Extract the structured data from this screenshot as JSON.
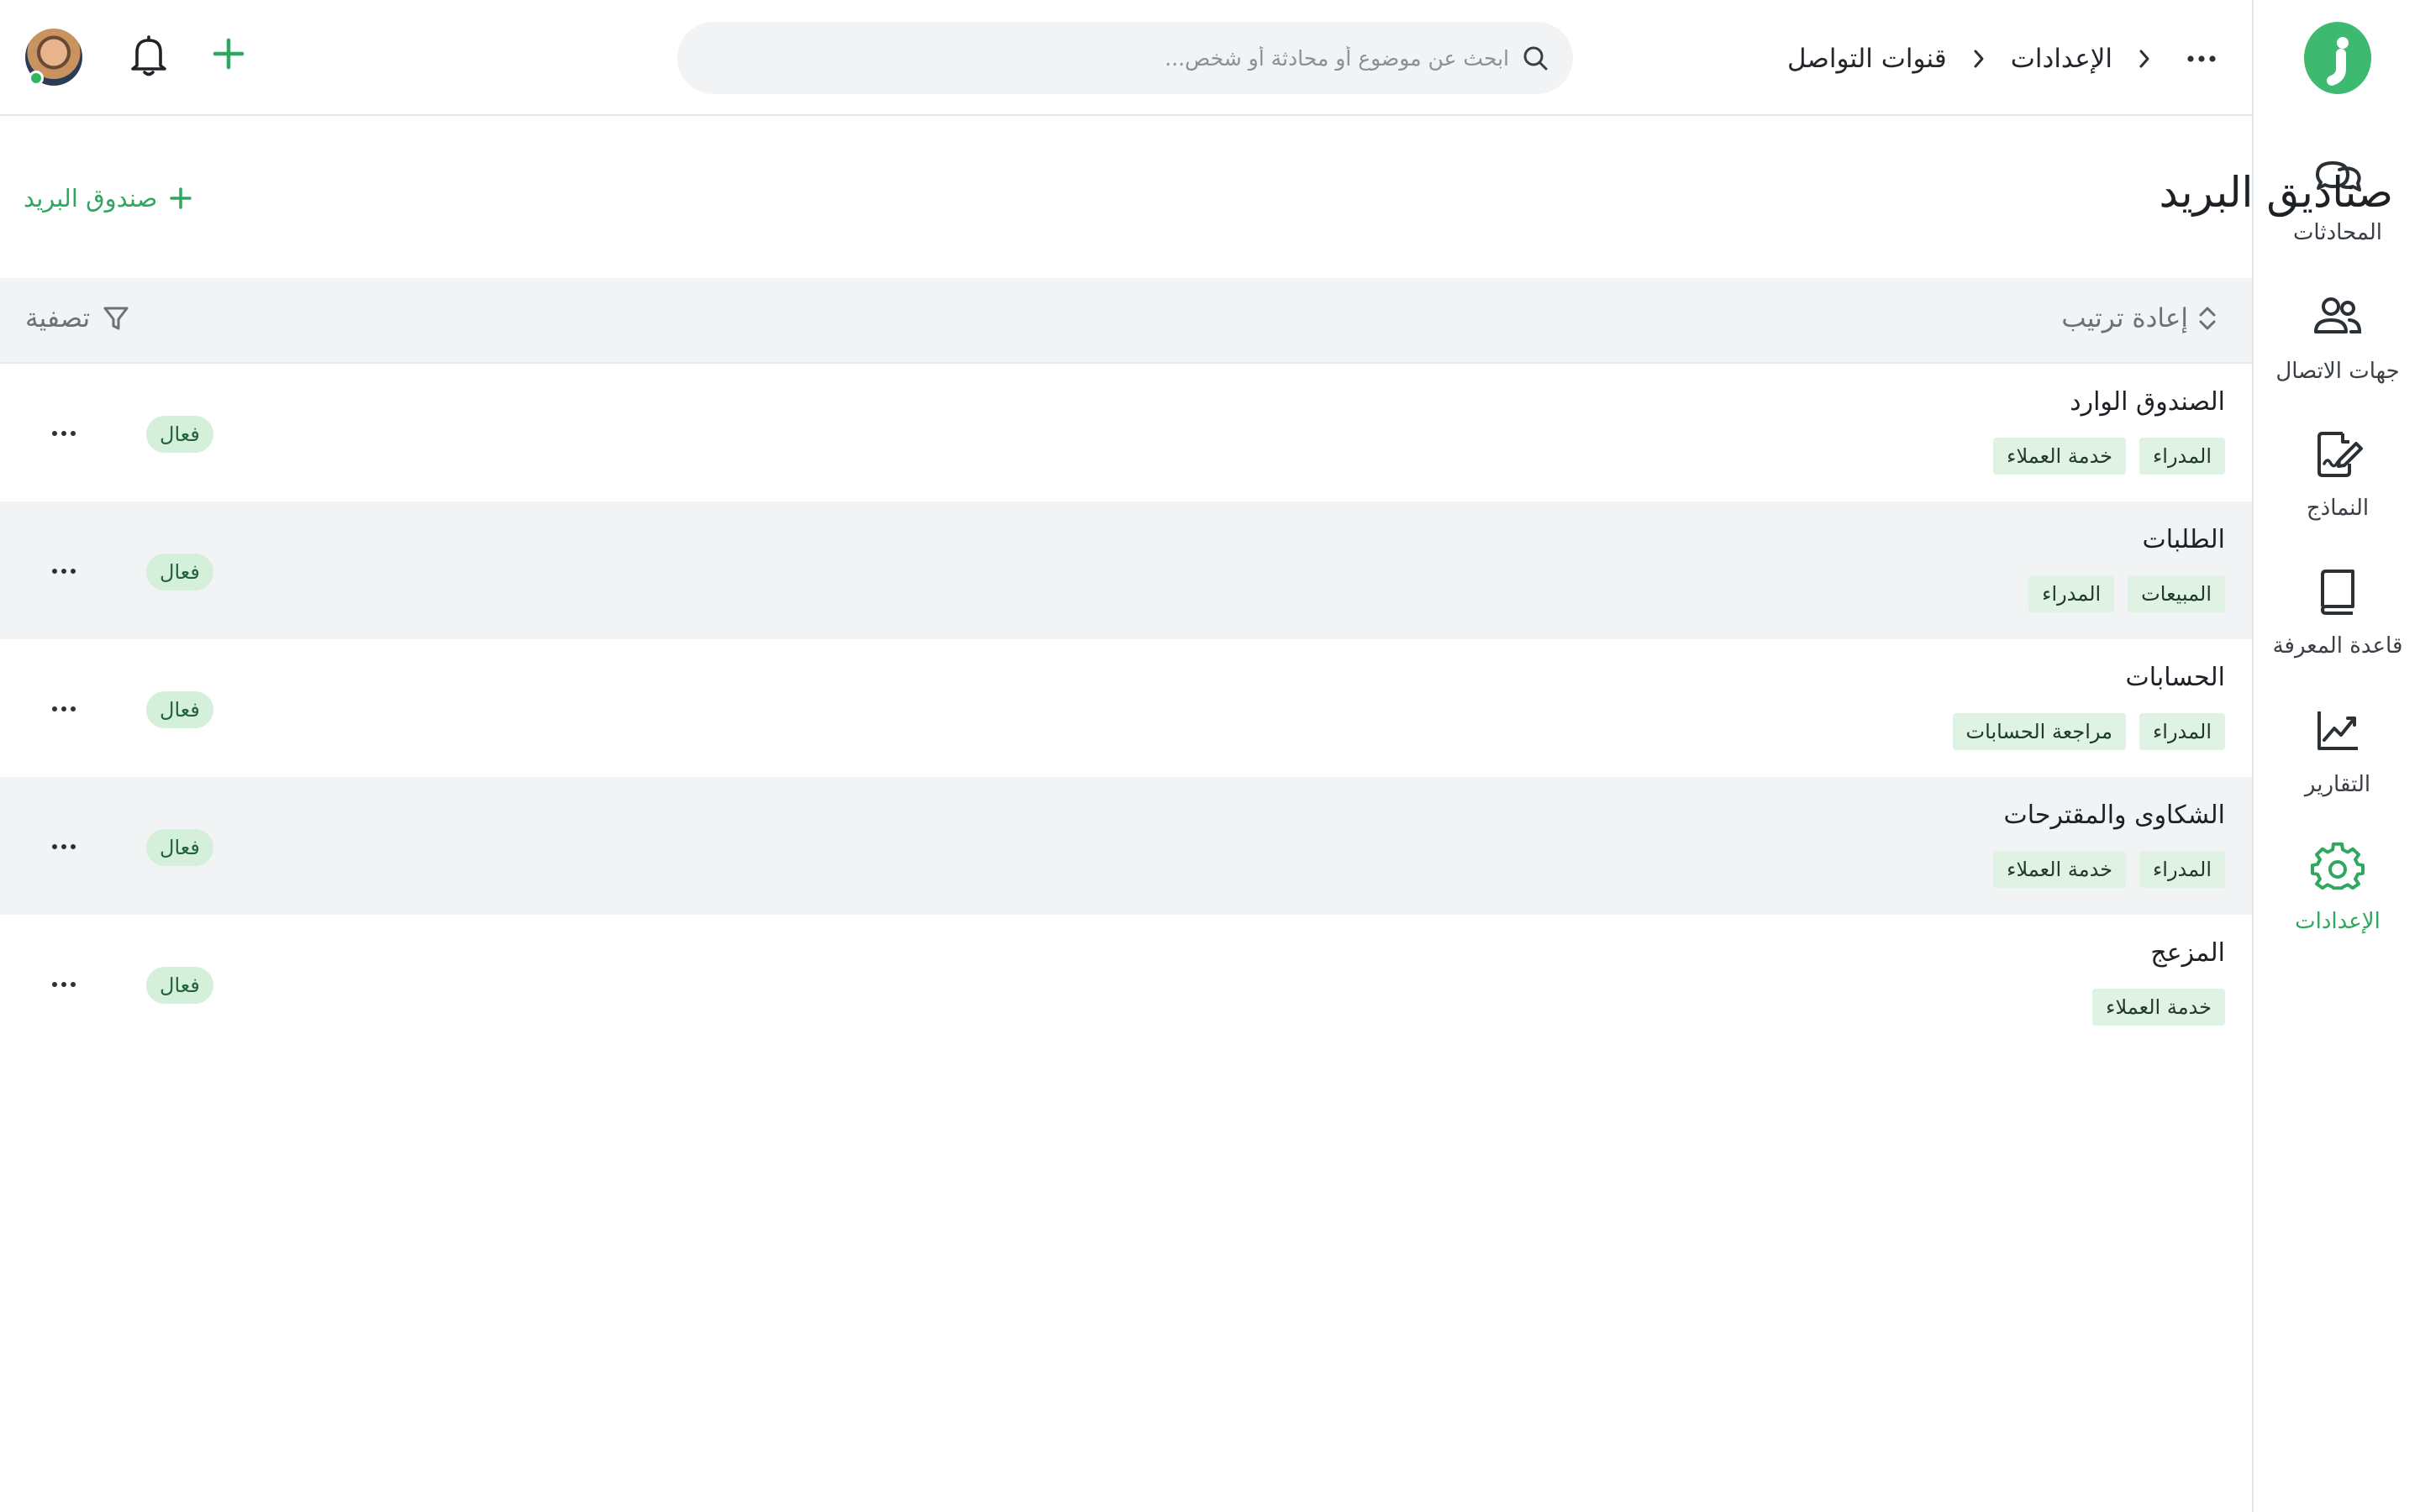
{
  "colors": {
    "accent": "#3dba6f",
    "accent_text": "#2fa75f",
    "tag_bg": "#dff2e4",
    "status_bg": "#d4efda",
    "toolbar_bg": "#f2f3f4",
    "online": "#2fb55f"
  },
  "sidebar": {
    "logo_icon": "info-logo-icon",
    "items": [
      {
        "label": "المحادثات",
        "icon": "chat-bubbles-icon",
        "active": false
      },
      {
        "label": "جهات الاتصال",
        "icon": "contacts-icon",
        "active": false
      },
      {
        "label": "النماذج",
        "icon": "form-edit-icon",
        "active": false
      },
      {
        "label": "قاعدة المعرفة",
        "icon": "book-icon",
        "active": false
      },
      {
        "label": "التقارير",
        "icon": "chart-line-icon",
        "active": false
      },
      {
        "label": "الإعدادات",
        "icon": "gear-icon",
        "active": true
      }
    ]
  },
  "header": {
    "breadcrumb": [
      "الإعدادات",
      "قنوات التواصل"
    ],
    "search_placeholder": "ابحث عن موضوع أو محادثة أو شخص..."
  },
  "page": {
    "title": "صناديق البريد",
    "add_button_label": "صندوق البريد"
  },
  "toolbar": {
    "reorder_label": "إعادة ترتيب",
    "filter_label": "تصفية"
  },
  "inboxes": [
    {
      "name": "الصندوق الوارد",
      "tags": [
        "المدراء",
        "خدمة العملاء"
      ],
      "status": "فعال"
    },
    {
      "name": "الطلبات",
      "tags": [
        "المبيعات",
        "المدراء"
      ],
      "status": "فعال"
    },
    {
      "name": "الحسابات",
      "tags": [
        "المدراء",
        "مراجعة الحسابات"
      ],
      "status": "فعال"
    },
    {
      "name": "الشكاوى والمقترحات",
      "tags": [
        "المدراء",
        "خدمة العملاء"
      ],
      "status": "فعال"
    },
    {
      "name": "المزعج",
      "tags": [
        "خدمة العملاء"
      ],
      "status": "فعال"
    }
  ]
}
